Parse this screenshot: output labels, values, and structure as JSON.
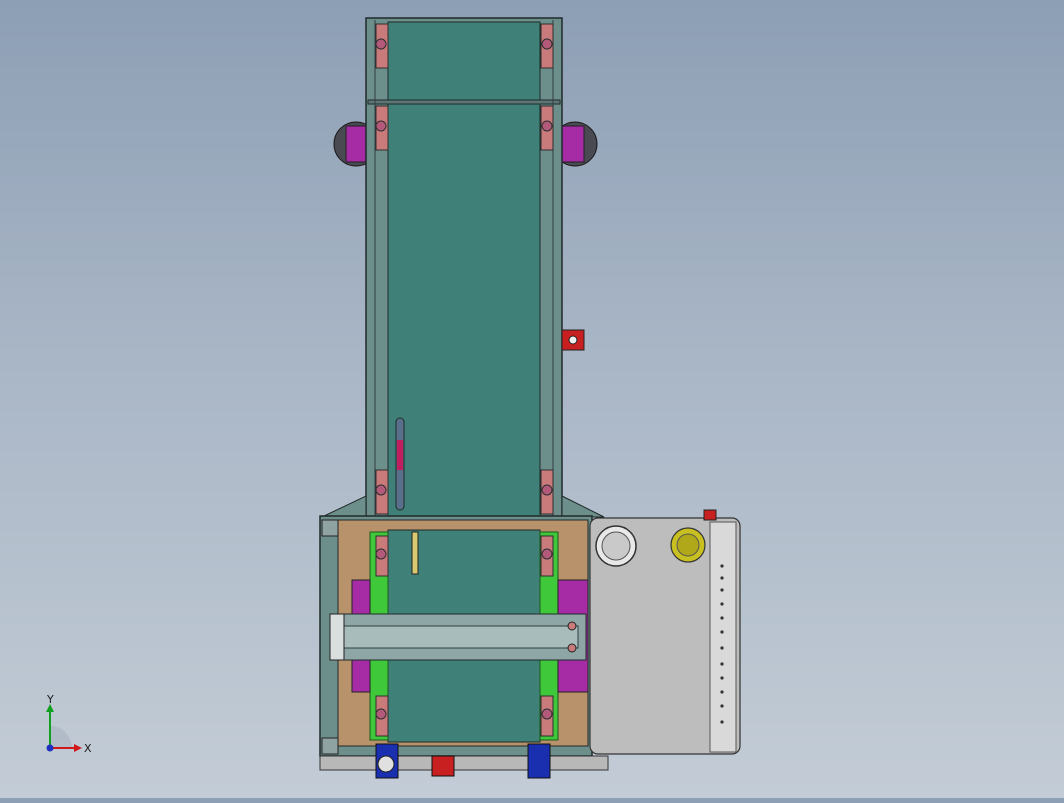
{
  "viewport": {
    "background_top": "#8d9fb5",
    "background_bottom": "#c3ccd6"
  },
  "triad": {
    "x_label": "X",
    "y_label": "Y",
    "x_color": "#d01818",
    "y_color": "#10a020",
    "z_color": "#2030c0"
  },
  "colors": {
    "belt": "#3f8078",
    "frame": "#6d8f8c",
    "frame_dark": "#2e3f40",
    "plate_brown": "#b8926a",
    "rail_green": "#3fc83a",
    "bracket_magenta": "#a52ca5",
    "gearbox_gray": "#bdbdbd",
    "motor_yellow": "#c8c020",
    "block_red": "#c82020",
    "block_blue": "#1a2fb0",
    "roller_pink": "#c97a7a"
  }
}
